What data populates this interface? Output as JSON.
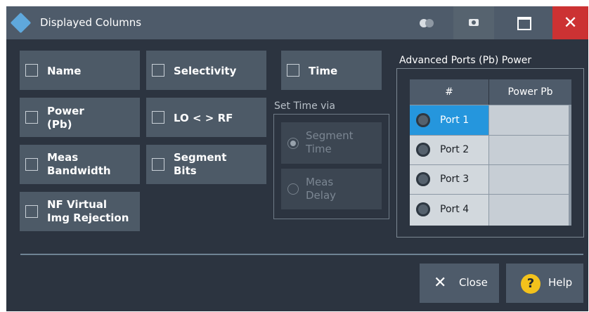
{
  "window": {
    "title": "Displayed Columns",
    "close_glyph": "✕"
  },
  "checkboxes": [
    {
      "line1": "Name",
      "line2": ""
    },
    {
      "line1": "Power",
      "line2": "(Pb)"
    },
    {
      "line1": "Meas",
      "line2": "Bandwidth"
    },
    {
      "line1": "NF Virtual",
      "line2": "Img Rejection"
    },
    {
      "line1": "Selectivity",
      "line2": ""
    },
    {
      "line1": "LO < > RF",
      "line2": ""
    },
    {
      "line1": "Segment",
      "line2": "Bits"
    },
    {
      "line1": "Time",
      "line2": ""
    }
  ],
  "set_time": {
    "label": "Set Time via",
    "options": [
      {
        "line1": "Segment",
        "line2": "Time",
        "selected": true
      },
      {
        "line1": "Meas",
        "line2": "Delay",
        "selected": false
      }
    ]
  },
  "advanced": {
    "title": "Advanced Ports (Pb) Power",
    "headers": [
      "#",
      "Power Pb"
    ],
    "rows": [
      {
        "port": "Port 1",
        "power": ""
      },
      {
        "port": "Port 2",
        "power": ""
      },
      {
        "port": "Port 3",
        "power": ""
      },
      {
        "port": "Port 4",
        "power": ""
      }
    ]
  },
  "buttons": {
    "close": "Close",
    "help": "Help",
    "close_glyph": "✕",
    "help_glyph": "?"
  },
  "colors": {
    "background": "#2c3440",
    "button": "#4e5b6a",
    "selection": "#2596dd",
    "close_red": "#cc3233",
    "help_yellow": "#f3c21c"
  }
}
